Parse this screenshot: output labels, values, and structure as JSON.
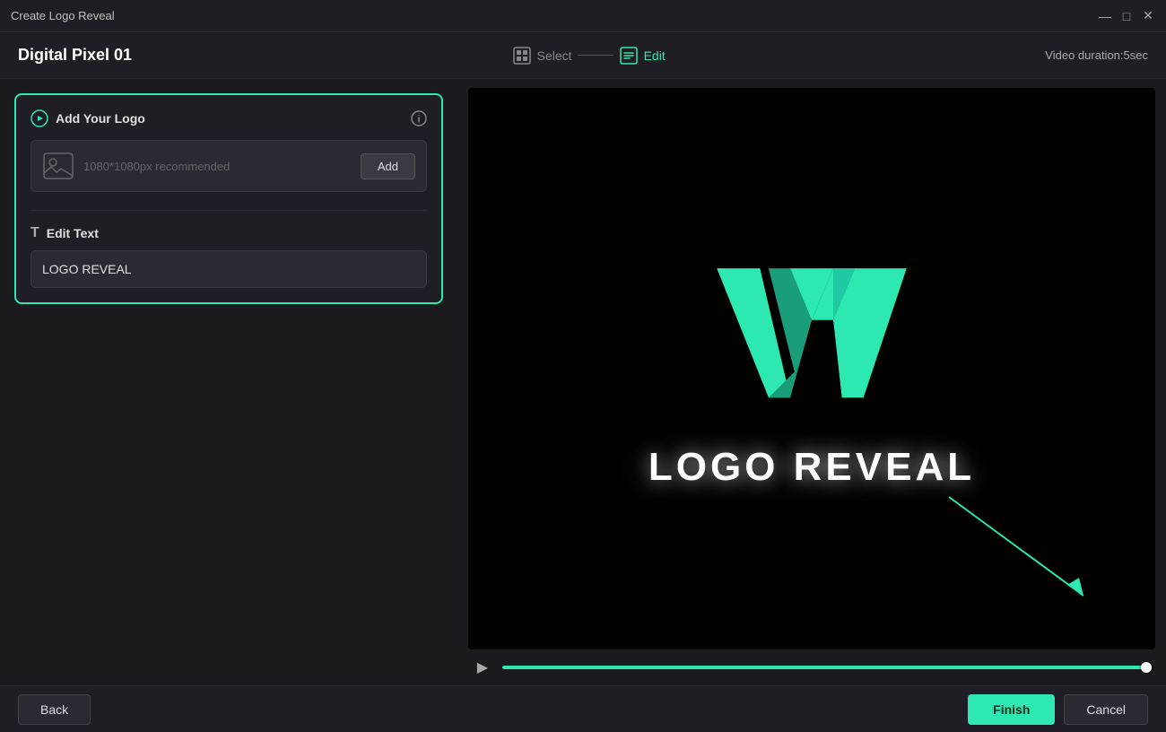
{
  "titleBar": {
    "title": "Create Logo Reveal",
    "controls": {
      "minimize": "—",
      "maximize": "□",
      "close": "✕"
    }
  },
  "topBar": {
    "appTitle": "Digital Pixel 01",
    "steps": [
      {
        "id": "select",
        "label": "Select",
        "active": false
      },
      {
        "id": "edit",
        "label": "Edit",
        "active": true
      }
    ],
    "duration": "Video duration:5sec"
  },
  "leftPanel": {
    "logoSection": {
      "title": "Add Your Logo",
      "placeholder": "1080*1080px recommended",
      "addButton": "Add"
    },
    "textSection": {
      "title": "Edit Text",
      "textValue": "LOGO REVEAL"
    }
  },
  "preview": {
    "logoText": "LOGO REVEAL"
  },
  "playback": {
    "playIcon": "▶",
    "progress": 100
  },
  "bottomBar": {
    "backButton": "Back",
    "finishButton": "Finish",
    "cancelButton": "Cancel"
  }
}
